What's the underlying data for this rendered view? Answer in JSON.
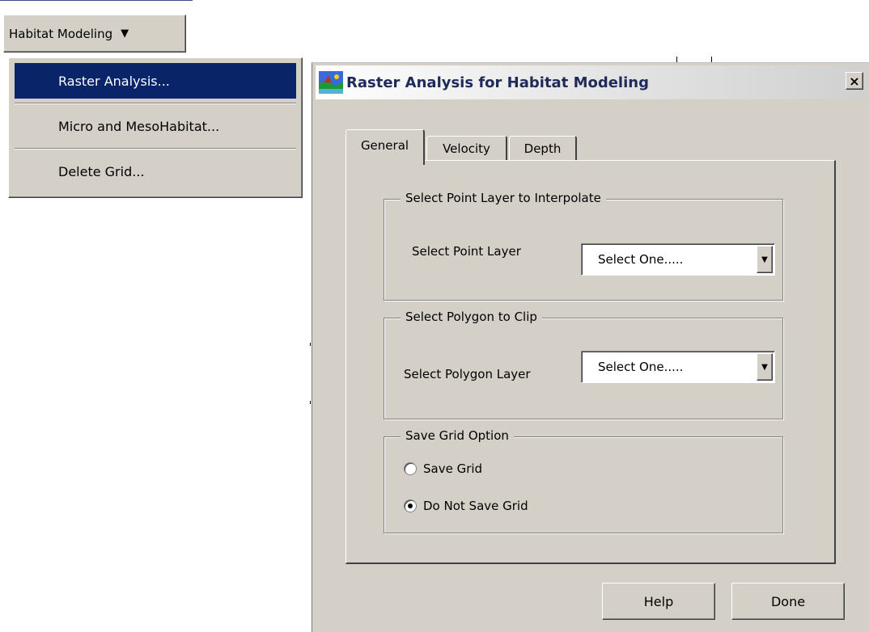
{
  "menu": {
    "button_label": "Habitat Modeling",
    "button_arrow": "▼",
    "items": [
      {
        "label": "Raster Analysis...",
        "active": true
      },
      {
        "label": "Micro and MesoHabitat..."
      },
      {
        "label": "Delete Grid..."
      }
    ]
  },
  "dialog": {
    "title": "Raster Analysis for Habitat Modeling",
    "close_glyph": "×",
    "tabs": [
      "General",
      "Velocity",
      "Depth"
    ],
    "point_group": {
      "legend": "Select Point Layer to Interpolate",
      "label": "Select Point Layer",
      "value": "Select One....."
    },
    "polygon_group": {
      "legend": "Select Polygon to Clip",
      "label": "Select Polygon Layer",
      "value": "Select One....."
    },
    "save_group": {
      "legend": "Save Grid Option",
      "options": [
        {
          "label": "Save Grid",
          "selected": false
        },
        {
          "label": "Do Not Save Grid",
          "selected": true
        }
      ]
    },
    "combo_arrow": "▼",
    "buttons": {
      "help": "Help",
      "done": "Done"
    }
  },
  "colors": {
    "menu_highlight": "#0a246a",
    "window_face": "#d4d0c8",
    "title_text": "#1e2a5a"
  }
}
